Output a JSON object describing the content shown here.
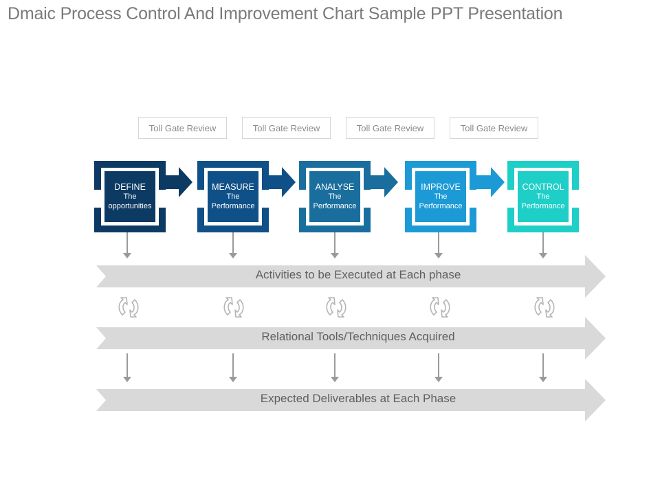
{
  "title": "Dmaic Process Control And Improvement Chart Sample PPT Presentation",
  "toll_gates": [
    {
      "label": "Toll Gate Review"
    },
    {
      "label": "Toll Gate Review"
    },
    {
      "label": "Toll Gate Review"
    },
    {
      "label": "Toll Gate Review"
    }
  ],
  "phases": [
    {
      "name": "DEFINE",
      "line1": "The",
      "line2": "opportunities",
      "color": "#0d3a63"
    },
    {
      "name": "MEASURE",
      "line1": "The",
      "line2": "Performance",
      "color": "#0f5088"
    },
    {
      "name": "ANALYSE",
      "line1": "The",
      "line2": "Performance",
      "color": "#1a6e9e"
    },
    {
      "name": "IMPROVE",
      "line1": "The",
      "line2": "Performance",
      "color": "#1b9ad6"
    },
    {
      "name": "CONTROL",
      "line1": "The",
      "line2": "Performance",
      "color": "#1ecfc8"
    }
  ],
  "bands": [
    {
      "label": "Activities to be Executed at Each phase"
    },
    {
      "label": "Relational Tools/Techniques Acquired"
    },
    {
      "label": "Expected Deliverables at Each Phase"
    }
  ],
  "colors": {
    "band": "#d9d9d9",
    "arrow_gray": "#9a9a9a",
    "icon_gray": "#b5b5b5",
    "title": "#7a7a7a"
  }
}
